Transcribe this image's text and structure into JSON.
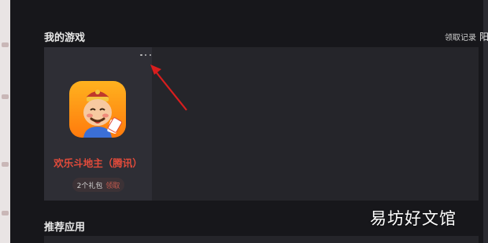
{
  "my_games": {
    "title": "我的游戏",
    "record_link": "领取记录",
    "extra_glyph": "阳",
    "game": {
      "name": "欢乐斗地主（腾讯）",
      "gift_count": "2个礼包",
      "claim_label": "领取"
    }
  },
  "recommend": {
    "title": "推荐应用"
  },
  "watermark": "易坊好文馆",
  "colors": {
    "background": "#17171b",
    "panel": "#25252a",
    "card": "#2e2e35",
    "game_name": "#e24b3b",
    "arrow": "#d81e1e"
  }
}
